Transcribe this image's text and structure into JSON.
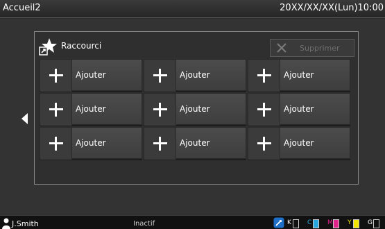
{
  "header": {
    "title": "Accueil2",
    "datetime": "20XX/XX/XX(Lun)10:00"
  },
  "panel": {
    "label": "Raccourci",
    "delete_label": "Supprimer",
    "tiles": [
      {
        "label": "Ajouter"
      },
      {
        "label": "Ajouter"
      },
      {
        "label": "Ajouter"
      },
      {
        "label": "Ajouter"
      },
      {
        "label": "Ajouter"
      },
      {
        "label": "Ajouter"
      },
      {
        "label": "Ajouter"
      },
      {
        "label": "Ajouter"
      },
      {
        "label": "Ajouter"
      }
    ]
  },
  "statusbar": {
    "user": "J.Smith",
    "status": "Inactif",
    "inks": [
      {
        "label": "K",
        "color": "#ffffff",
        "level": 0
      },
      {
        "label": "C",
        "color": "#29a8e0",
        "level": 1
      },
      {
        "label": "M",
        "color": "#e0248c",
        "level": 1
      },
      {
        "label": "Y",
        "color": "#f2e600",
        "level": 1
      },
      {
        "label": "G",
        "color": "#ffffff",
        "level": 0
      }
    ]
  },
  "colors": {
    "toner_accent": "#1e6fc8",
    "disabled_text": "#6e6e6e"
  }
}
